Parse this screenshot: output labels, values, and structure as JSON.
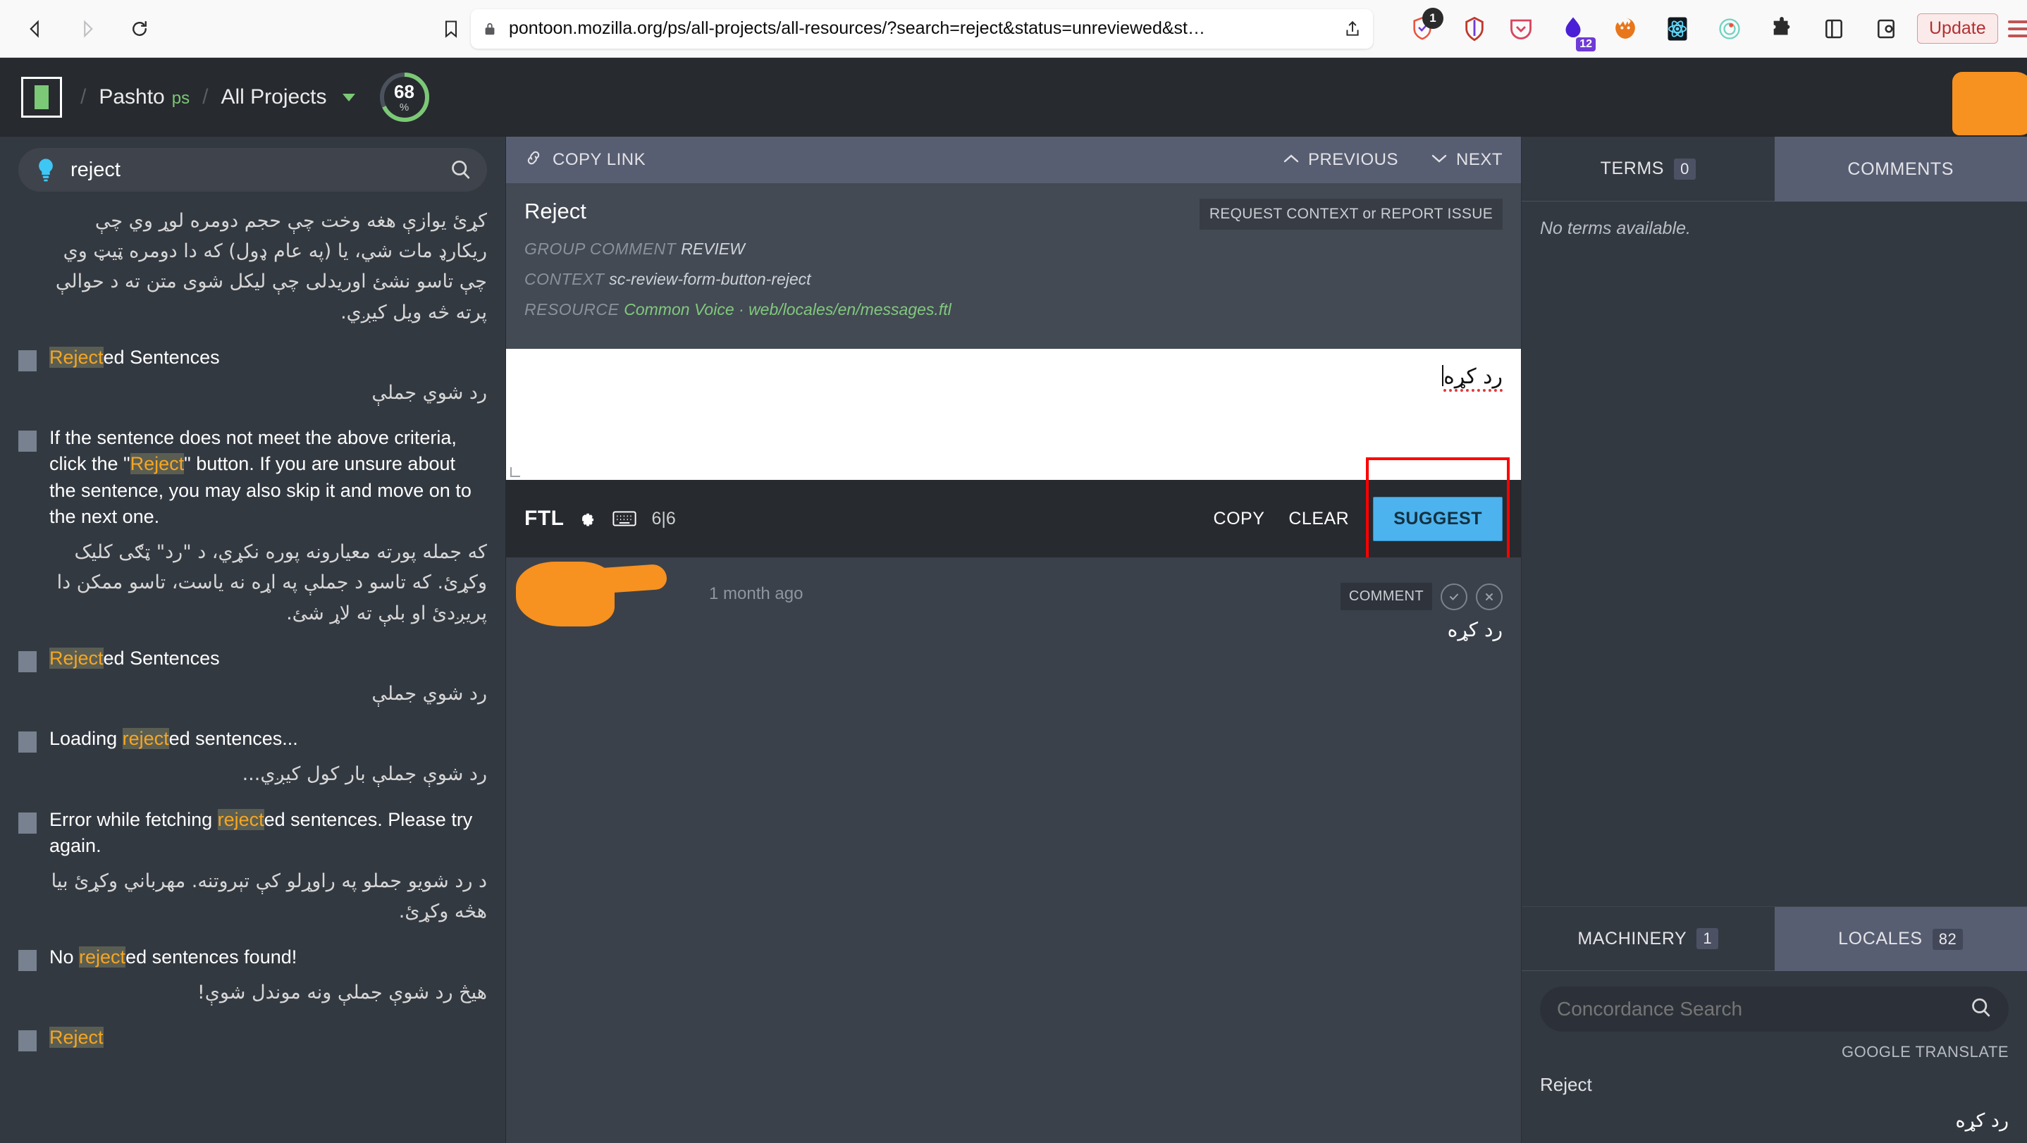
{
  "browser": {
    "back_icon": "back-arrow-icon",
    "forward_icon": "forward-arrow-icon",
    "reload_icon": "reload-icon",
    "bookmark_icon": "bookmark-icon",
    "lock_icon": "padlock-icon",
    "url_visible": "pontoon.mozilla.org/ps/all-projects/all-resources/?search=reject&status=unreviewed&st…",
    "url_domain": "pontoon.mozilla.org",
    "url_path": "/ps/all-projects/all-resources/?search=reject&status=unreviewed&st…",
    "share_icon": "share-upload-icon",
    "extensions": [
      {
        "name": "brave-shield-icon",
        "badge": "1"
      },
      {
        "name": "bitwarden-icon",
        "badge": ""
      },
      {
        "name": "pocket-icon",
        "badge": ""
      },
      {
        "name": "raindrop-icon",
        "badge": "12"
      },
      {
        "name": "firefox-fox-icon",
        "badge": ""
      },
      {
        "name": "react-devtools-icon",
        "badge": ""
      },
      {
        "name": "radar-icon",
        "badge": ""
      },
      {
        "name": "puzzle-extensions-icon",
        "badge": ""
      },
      {
        "name": "sidebar-icon",
        "badge": ""
      },
      {
        "name": "container-tabs-icon",
        "badge": ""
      }
    ],
    "update_label": "Update",
    "menu_icon": "hamburger-menu-icon"
  },
  "header": {
    "logo": "pontoon-logo",
    "separator": "/",
    "locale_name": "Pashto",
    "locale_code": "ps",
    "project_name": "All Projects",
    "project_caret": "chevron-down-icon",
    "progress_value": "68",
    "progress_unit": "%",
    "progress_percent": 68,
    "progress_color": "#7bc876",
    "bell_icon": "notifications-bell-icon",
    "avatar": "user-avatar-redacted"
  },
  "sidebar": {
    "search": {
      "bulb_icon": "lightbulb-icon",
      "value": "reject",
      "placeholder": "Search",
      "search_icon": "search-icon"
    },
    "entries": [
      {
        "source_pre": "",
        "source_hl": "",
        "source_post": "",
        "target": "کړئ یوازې هغه وخت چې حجم دومره لوړ وي چې ریکارډ مات شي، یا (په عام ډول) که دا دومره ټیټ وي چې تاسو نشئ اوریدلی چې لیکل شوی متن ته د حوالې پرته څه ویل کیږي."
      },
      {
        "source_pre": "",
        "source_hl": "Reject",
        "source_post": "ed Sentences",
        "target": "رد شوي جملې"
      },
      {
        "source_pre": "If the sentence does not meet the above criteria, click the \"",
        "source_hl": "Reject",
        "source_post": "\" button. If you are unsure about the sentence, you may also skip it and move on to the next one.",
        "target": "که جمله پورته معیارونه پوره نکړي، د \"رد\" ټګی کلیک وکړئ. که تاسو د جملې په اړه نه یاست، تاسو ممکن دا پریږدئ او بلې ته لاړ شئ."
      },
      {
        "source_pre": "",
        "source_hl": "Reject",
        "source_post": "ed Sentences",
        "target": "رد شوي جملې"
      },
      {
        "source_pre": "Loading ",
        "source_hl": "reject",
        "source_post": "ed sentences...",
        "target": "رد شوې جملې بار کول کیږي..."
      },
      {
        "source_pre": "Error while fetching ",
        "source_hl": "reject",
        "source_post": "ed sentences. Please try again.",
        "target": "د رد شویو جملو په راوړلو کې تېروتنه. مهرباني وکړئ بیا هڅه وکړئ."
      },
      {
        "source_pre": "No ",
        "source_hl": "reject",
        "source_post": "ed sentences found!",
        "target": "هیڅ رد شوې جملې ونه موندل شوې!"
      },
      {
        "source_pre": "",
        "source_hl": "Reject",
        "source_post": "",
        "target": ""
      }
    ]
  },
  "editor": {
    "topbar": {
      "copy_link_icon": "link-chain-icon",
      "copy_link_label": "COPY LINK",
      "previous_icon": "chevron-up-icon",
      "previous_label": "PREVIOUS",
      "next_icon": "chevron-down-icon",
      "next_label": "NEXT"
    },
    "original_string": "Reject",
    "request_context_label": "REQUEST CONTEXT or REPORT ISSUE",
    "meta": [
      {
        "key": "GROUP COMMENT",
        "value": "REVIEW",
        "style": "plain"
      },
      {
        "key": "CONTEXT",
        "value": "sc-review-form-button-reject",
        "style": "plain"
      },
      {
        "key": "RESOURCE",
        "value": "Common Voice · web/locales/en/messages.ftl",
        "style": "resource"
      }
    ],
    "translation_value": "رد کړه",
    "toolbar": {
      "format_label": "FTL",
      "settings_icon": "gear-icon",
      "keyboard_icon": "keyboard-icon",
      "char_count": "6|6",
      "copy_label": "COPY",
      "clear_label": "CLEAR",
      "suggest_label": "SUGGEST",
      "suggest_color": "#4cb3ee",
      "highlight_color": "#ff0000"
    },
    "history": [
      {
        "author": "redacted-username",
        "time": "1 month ago",
        "comment_tooltip": "COMMENT",
        "approve_icon": "approve-check-icon",
        "reject_icon": "reject-cross-icon",
        "translation": "رد کړه"
      }
    ]
  },
  "right_panel": {
    "top_tabs": [
      {
        "label": "TERMS",
        "count": "0",
        "active": false
      },
      {
        "label": "COMMENTS",
        "count": "",
        "active": true
      }
    ],
    "terms_empty": "No terms available.",
    "bottom_tabs": [
      {
        "label": "MACHINERY",
        "count": "1",
        "active": false
      },
      {
        "label": "LOCALES",
        "count": "82",
        "active": true
      }
    ],
    "concordance": {
      "placeholder": "Concordance Search",
      "value": "",
      "search_icon": "search-icon"
    },
    "machinery_results": [
      {
        "provider": "GOOGLE TRANSLATE",
        "source": "Reject",
        "target": "رد کړه"
      }
    ]
  }
}
